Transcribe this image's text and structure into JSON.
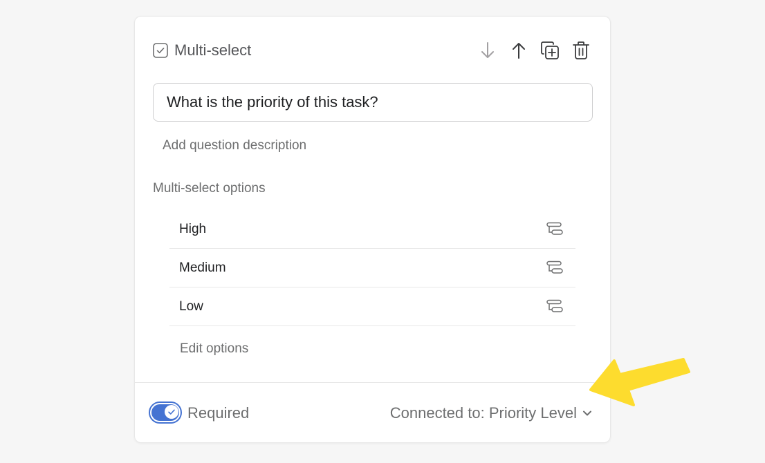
{
  "question": {
    "type_label": "Multi-select",
    "type_icon": "checkbox-icon",
    "title": "What is the priority of this task?",
    "add_description": "Add question description"
  },
  "actions": [
    {
      "name": "move-down",
      "icon": "arrow-down-icon",
      "enabled": false
    },
    {
      "name": "move-up",
      "icon": "arrow-up-icon",
      "enabled": true
    },
    {
      "name": "duplicate",
      "icon": "duplicate-icon",
      "enabled": true
    },
    {
      "name": "delete",
      "icon": "trash-icon",
      "enabled": true
    }
  ],
  "options_section": {
    "label": "Multi-select options",
    "options": [
      {
        "label": "High",
        "icon": "branch-icon"
      },
      {
        "label": "Medium",
        "icon": "branch-icon"
      },
      {
        "label": "Low",
        "icon": "branch-icon"
      }
    ],
    "edit_label": "Edit options"
  },
  "footer": {
    "required_on": true,
    "required_label": "Required",
    "connected_label": "Connected to: Priority Level",
    "connected_icon": "chevron-down-icon"
  },
  "annotation": {
    "icon": "yellow-arrow-icon",
    "color": "#fddc2e"
  },
  "colors": {
    "accent": "#4573d2",
    "muted_text": "#6d6e6f",
    "border": "#e8e8e8",
    "background": "#f6f6f6"
  }
}
